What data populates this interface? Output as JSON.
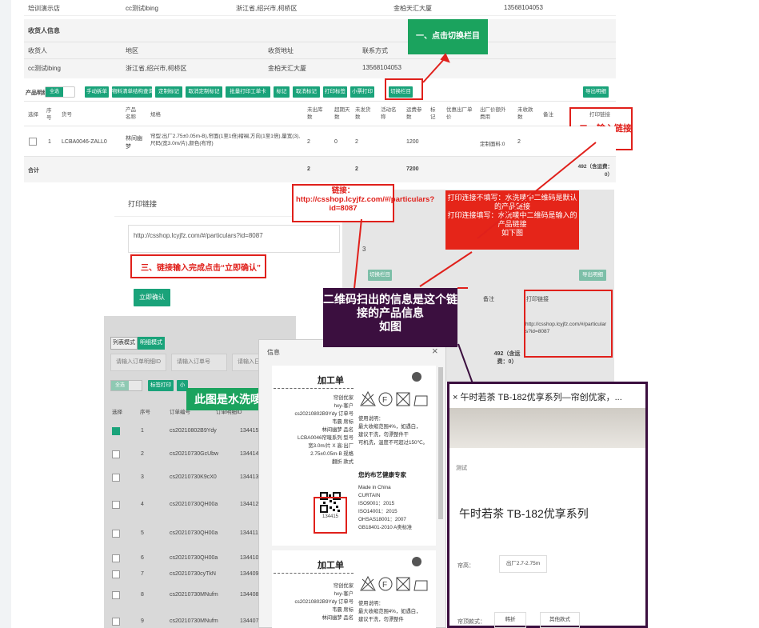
{
  "top_row": {
    "name": "培训演示店",
    "account": "cc测试ibing",
    "region": "浙江省,绍兴市,柯桥区",
    "address": "金柏天汇大厦",
    "phone": "13568104053"
  },
  "receiver": {
    "section_title": "收货人信息",
    "headers": [
      "收货人",
      "地区",
      "收货地址",
      "联系方式"
    ],
    "values": [
      "cc测试ibing",
      "浙江省,绍兴市,柯桥区",
      "金柏天汇大厦",
      "13568104053"
    ]
  },
  "toolbar": {
    "title": "产品明细",
    "toggle": "全选",
    "buttons": [
      "手动拆单",
      "物料清单结构查询",
      "定制标记",
      "取消定制标记",
      "批量打印工单卡",
      "标记",
      "取消标记",
      "打印标签",
      "小票打印",
      "切换栏目"
    ],
    "export": "导出明细"
  },
  "table": {
    "headers": [
      "选择",
      "序号",
      "货号",
      "产品名称",
      "规格",
      "未出库数",
      "超期天数",
      "未发货数",
      "活动名称",
      "运费参数",
      "标记",
      "优惠出厂单价",
      "出厂价额外费用",
      "未收款数",
      "备注",
      "打印链接"
    ],
    "row": {
      "index": "1",
      "sku": "LCBA0046-ZALL0",
      "name": "林间幽梦",
      "spec": "帘型:出厂2.75±0.05m-B),帘面(1至1倍)褶裥,方向(1至1倍),量宽(3),尺码(宽3.0m/片),颜色(布帘)",
      "a": "2",
      "b": "0",
      "c": "2",
      "d": "1200",
      "e": "定制面料:0",
      "f": "2"
    },
    "total_label": "合计",
    "total_a": "2",
    "total_c": "2",
    "total_d": "7200",
    "total_note": "492（含运费：0）"
  },
  "annotations": {
    "step1": "一、点击切换栏目",
    "step2": "二、输入链接",
    "step3": "三、链接输入完成点击“立即确认”",
    "link_note": "链接：http://csshop.lcyjfz.com/#/particulars?id=8087",
    "red_note": "打印连接不填写：水洗唛中二维码是默认的产品链接\n打印连接填写：水洗唛中二维码是输入的产品链接\n如下图",
    "purple_note": "二维码扫出的信息是这个链接的产品信息\n如图",
    "green_note": "此图是水洗唛打印"
  },
  "dialog": {
    "title": "打印链接",
    "input_value": "http://csshop.lcyjfz.com/#/particulars?id=8087",
    "confirm": "立即确认"
  },
  "bg_panel": {
    "btn1": "切换栏目",
    "btn2": "导出明细",
    "col1": "备注",
    "col2": "打印链接",
    "url": "http://csshop.lcyjfz.com/#/particulars?id=8087",
    "note": "492（含运费：0）",
    "num": "3"
  },
  "list": {
    "tabs": [
      "列表模式",
      "明细模式"
    ],
    "search1": "请输入订单明细ID",
    "search2": "请输入订单号",
    "search3": "请输入日",
    "buttons": [
      "全选",
      "标签打印",
      "小"
    ],
    "headers": [
      "选择",
      "序号",
      "订单编号",
      "订单明细ID"
    ],
    "rows": [
      {
        "n": "1",
        "order": "cs20210802B9Ydy",
        "id": "134415"
      },
      {
        "n": "2",
        "order": "cs20210730GcUbw",
        "id": "134414"
      },
      {
        "n": "3",
        "order": "cs20210730K9cX0",
        "id": "134413"
      },
      {
        "n": "4",
        "order": "cs20210730QH00a",
        "id": "134412"
      },
      {
        "n": "5",
        "order": "cs20210730QH00a",
        "id": "134411"
      },
      {
        "n": "6",
        "order": "cs20210730QH00a",
        "id": "134410"
      },
      {
        "n": "7",
        "order": "cs20210730cyTkN",
        "id": "134409"
      },
      {
        "n": "8",
        "order": "cs20210730MNufm",
        "id": "134408"
      },
      {
        "n": "9",
        "order": "cs20210730MNufm",
        "id": "134407"
      }
    ]
  },
  "info": {
    "title": "信息",
    "close": "×",
    "card_title": "加工单",
    "lines_left": [
      "帘创优家",
      "hxy-客户",
      "cs20210802B9Ydy 订单号",
      "韦晨 席标",
      "林间幽梦 品名",
      "LCBA0046帘唛系列 型号",
      "宽3.0m/片 X 高:出厂",
      "2.75±0.05m-B 规格",
      "翻折 款式"
    ],
    "qr_num": "134415",
    "usage": [
      "使用说明：",
      "最大收缩范围4%，如遇白，",
      "建议干洗，勿漂整件干",
      "可机洗，温度不可超过150℃。"
    ],
    "brand": "您的布艺健康专家",
    "certs": [
      "Made in China",
      "CURTAIN",
      "ISO9001：2015",
      "ISO14001：2015",
      "OHSAS18001：2007",
      "GB18401-2010 A类标准"
    ],
    "card2_title": "加工单",
    "lines2": [
      "帘创优家",
      "hxy-客户",
      "cs20210802B9Ydy 订单号",
      "韦晨 席标",
      "林间幽梦 品名"
    ],
    "usage2": [
      "使用说明：",
      "最大收缩范围4%，如遇白，",
      "建议干洗，勿漂整件"
    ]
  },
  "product": {
    "header": "×  午时若茶 TB-182优享系列—帘创优家，...",
    "more": "···",
    "tag": "测试",
    "title": "午时若茶 TB-182优享系列",
    "label1": "帘高：",
    "value1": "出厂2.7-2.75m",
    "label2": "帘顶款式：",
    "opt1": "韩折",
    "opt2": "其他款式"
  }
}
